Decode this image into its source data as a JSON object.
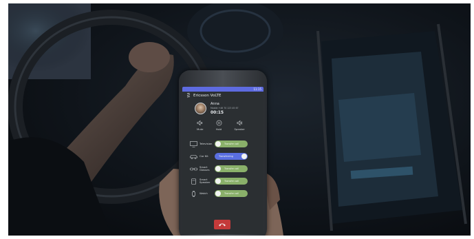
{
  "app": {
    "title": "Ericsson VoLTE",
    "status_time": "11:15"
  },
  "call": {
    "name": "Anna",
    "number": "Mobile +46 70 123 45 67",
    "duration": "00:15"
  },
  "controls": [
    {
      "label": "Mute",
      "icon": "mute-icon"
    },
    {
      "label": "Hold",
      "icon": "hold-icon"
    },
    {
      "label": "Speaker",
      "icon": "speaker-icon"
    }
  ],
  "devices": [
    {
      "name": "Television",
      "action": "Transfer call",
      "icon": "television-icon",
      "active": false
    },
    {
      "name": "Car Kit",
      "action": "Transferring",
      "icon": "car-icon",
      "active": true
    },
    {
      "name": "Smart Glasses",
      "action": "Transfer call",
      "icon": "glasses-icon",
      "active": false
    },
    {
      "name": "Smart Speaker",
      "action": "Transfer call",
      "icon": "smart-speaker-icon",
      "active": false
    },
    {
      "name": "Watch",
      "action": "Transfer call",
      "icon": "watch-icon",
      "active": false
    }
  ],
  "colors": {
    "status_bar": "#5e6be0",
    "pill_idle": "#8ab06a",
    "pill_active": "#5a6fe0",
    "end_call": "#c43a3a"
  }
}
